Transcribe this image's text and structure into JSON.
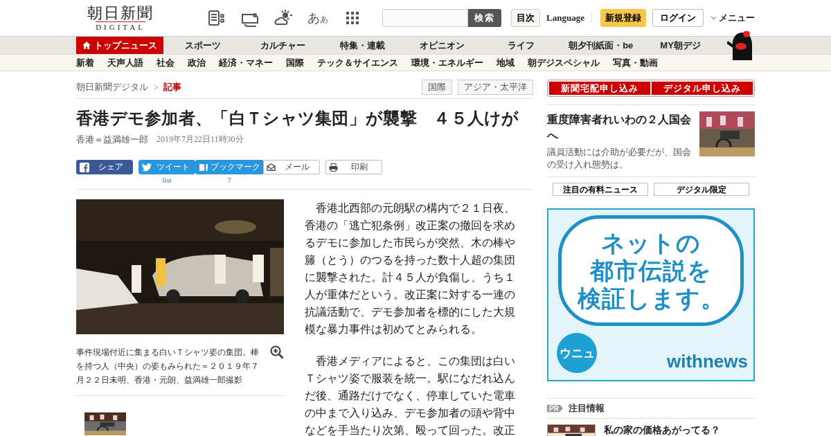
{
  "header": {
    "logo": {
      "title": "朝日新聞",
      "subtitle": "DIGITAL"
    },
    "font_size_button": {
      "large": "あ",
      "small": "あ"
    },
    "search": {
      "button": "検索"
    },
    "index_button": "目次",
    "language": "Language",
    "register": "新規登録",
    "login": "ログイン",
    "menu": "メニュー"
  },
  "main_nav": [
    {
      "label": "トップニュース",
      "selected": true
    },
    {
      "label": "スポーツ",
      "selected": false
    },
    {
      "label": "カルチャー",
      "selected": false
    },
    {
      "label": "特集・連載",
      "selected": false
    },
    {
      "label": "オピニオン",
      "selected": false
    },
    {
      "label": "ライフ",
      "selected": false
    },
    {
      "label": "朝夕刊紙面・be",
      "selected": false
    },
    {
      "label": "MY朝デジ",
      "selected": false
    }
  ],
  "sub_nav": [
    "新着",
    "天声人語",
    "社会",
    "政治",
    "経済・マネー",
    "国際",
    "テック＆サイエンス",
    "環境・エネルギー",
    "地域",
    "朝デジスペシャル",
    "写真・動画"
  ],
  "breadcrumb": [
    "朝日新聞デジタル",
    "記事"
  ],
  "breadcrumb_separator": ">",
  "tags": [
    "国際",
    "アジア・太平洋"
  ],
  "article": {
    "title": "香港デモ参加者、「白Ｔシャツ集団」が襲撃　４５人けが",
    "byline": "香港＝益満雄一郎",
    "date": "2019年7月22日11時30分",
    "share": [
      {
        "kind": "facebook",
        "label": "シェア"
      },
      {
        "kind": "twitter",
        "label": "ツイート",
        "count": "list"
      },
      {
        "kind": "hatena",
        "label": "ブックマーク",
        "count": "7"
      },
      {
        "kind": "mail",
        "label": "メール"
      },
      {
        "kind": "print",
        "label": "印刷"
      }
    ],
    "photo": {
      "caption": "事件現場付近に集まる白いＴシャツ姿の集団。棒を持つ人（中央）の姿もみられた＝２０１９年７月２２日未明、香港・元朗、益満雄一郎撮影"
    },
    "paragraphs": [
      "香港北西部の元朗駅の構内で２１日夜、香港の「逃亡犯条例」改正案の撤回を求めるデモに参加した市民らが突然、木の棒や籐（とう）のつるを持った数十人超の集団に襲撃された。計４５人が負傷し、うち１人が重体だという。改正案に対する一連の抗議活動で、デモ参加者を標的にした大規模な暴力事件は初めてとみられる。",
      "香港メディアによると、この集団は白いＴシャツ姿で服装を統一。駅になだれ込んだ後、通路だけでなく、停車していた電車の中まで入り込み、デモ参加者の頭や背中などを手当たり次第、殴って回った。改正"
    ]
  },
  "sidebar": {
    "subscribe": [
      "新聞宅配申し込み",
      "デジタル申し込み"
    ],
    "feature": {
      "title": "重度障害者れいわの２人国会へ",
      "summary": "議員活動には介助が必要だが、国会の受け入れ態勢は。"
    },
    "tabs": [
      {
        "label": "注目の有料ニュース"
      },
      {
        "label": "デジタル限定"
      }
    ],
    "ad": {
      "lines": [
        "ネットの",
        "都市伝説を",
        "検証します。"
      ],
      "badge": "ウニュ",
      "brand": "withnews"
    },
    "pr": {
      "badge": "PR",
      "title": "注目情報",
      "items": [
        {
          "title": "私の家の価格あがってる？"
        }
      ]
    }
  }
}
